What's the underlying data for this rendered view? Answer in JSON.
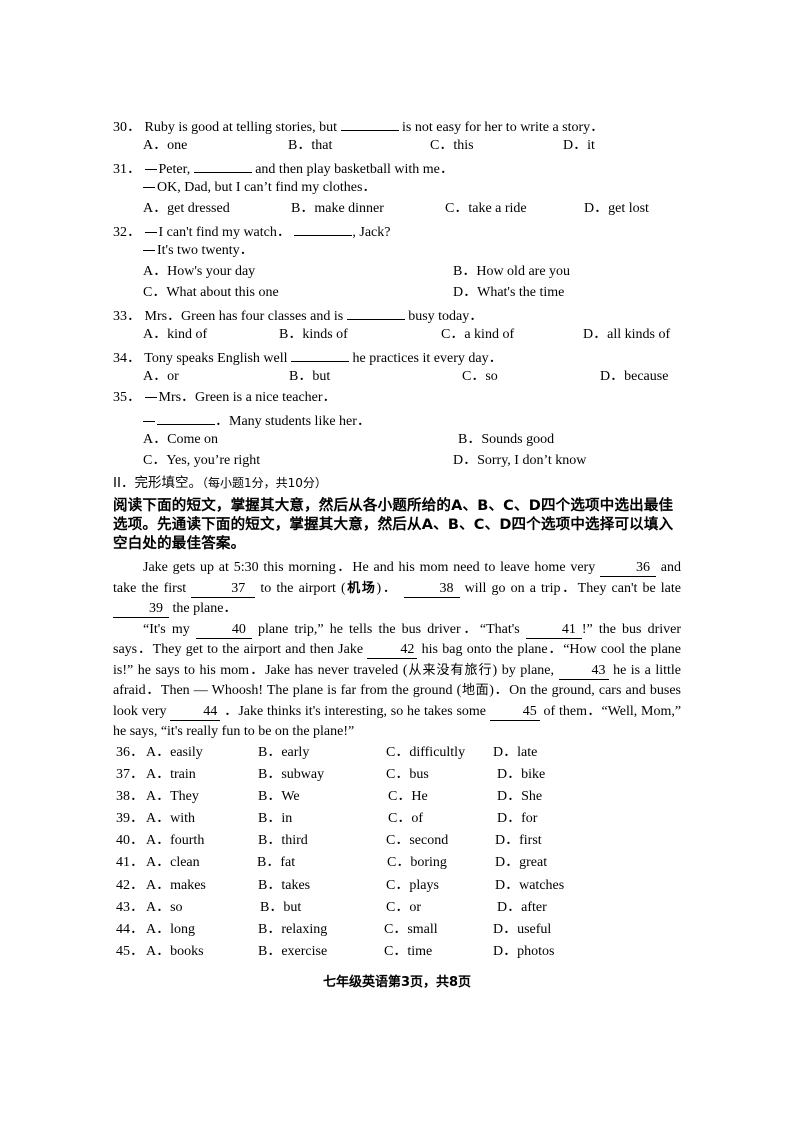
{
  "questions": [
    {
      "num": "30．",
      "stem_before": "Ruby is good at telling stories, but",
      "stem_after": "is not easy for her to write a story．",
      "options": [
        "A．one",
        "B．that",
        "C．this",
        "D．it"
      ]
    },
    {
      "num": "31．",
      "dialog": [
        "Peter,",
        "and then play basketball with me．",
        "OK, Dad, but I can’t find my clothes．"
      ],
      "options": [
        "A．get dressed",
        "B．make dinner",
        "C．take a ride",
        "D．get lost"
      ]
    },
    {
      "num": "32．",
      "dialog": [
        "I can't find my watch．",
        ", Jack?",
        "It's two twenty．"
      ],
      "options": [
        "A．How's your day",
        "B．How old are you",
        "C．What about this one",
        "D．What's the time"
      ]
    },
    {
      "num": "33．",
      "stem_before": "Mrs．Green has four classes and is",
      "stem_after": "busy today．",
      "options": [
        "A．kind of",
        "B．kinds of",
        "C．a kind of",
        "D．all kinds of"
      ]
    },
    {
      "num": "34．",
      "stem_before": "Tony speaks English well",
      "stem_after": "he practices it every day．",
      "options": [
        "A．or",
        "B．but",
        "C．so",
        "D．because"
      ]
    },
    {
      "num": "35．",
      "dialog": [
        "Mrs．Green is a nice teacher．",
        "．Many students like her．"
      ],
      "options": [
        "A．Come on",
        "B．Sounds good",
        "C．Yes, you’re right",
        "D．Sorry, I don’t know"
      ]
    }
  ],
  "section2": {
    "title": "II．完形填空。",
    "points": "（每小题1分，共10分）",
    "instructions": "阅读下面的短文，掌握其大意，然后从各小题所给的A、B、C、D四个选项中选出最佳选项。先通读下面的短文，掌握其大意，然后从A、B、C、D四个选项中选择可以填入空白处的最佳答案。"
  },
  "passage": {
    "p1": {
      "t1": "Jake gets up at 5:30 this morning．He and his mom need to leave home very",
      "b36": "36",
      "t2": "and take the first",
      "b37": "37",
      "t3": "to the airport (",
      "cn1": "机场",
      "t4": ")．",
      "b38": "38",
      "t5": "will go on a trip．They can't be late",
      "b39": "39",
      "t6": "the plane．"
    },
    "p2": {
      "t1": "“It's my",
      "b40": "40",
      "t2": "plane trip,” he tells the bus driver．“That's",
      "b41": "41",
      "t3": "!” the bus driver says．They get to the airport and then Jake",
      "b42": "42",
      "t4": "his bag onto the plane．“How cool the plane is!” he says to his mom．Jake has never traveled (",
      "cn1": "从来没有旅行",
      "t5": ") by plane,",
      "b43": "43",
      "t6": "he is a little afraid．Then — Whoosh! The plane is far from the ground (",
      "cn2": "地面",
      "t7": ")．On the ground, cars and buses look very",
      "b44": "44",
      "t8": "．Jake thinks it's interesting, so he takes some",
      "b45": "45",
      "t9": "of them．“Well, Mom,” he says, “it's really fun to be on the plane!”"
    }
  },
  "cloze": [
    {
      "num": "36．",
      "options": [
        "A．easily",
        "B．early",
        "C．difficultly",
        "D．late"
      ]
    },
    {
      "num": "37．",
      "options": [
        "A．train",
        "B．subway",
        "C．bus",
        "D．bike"
      ]
    },
    {
      "num": "38．",
      "options": [
        "A．They",
        "B．We",
        "C．He",
        "D．She"
      ]
    },
    {
      "num": "39．",
      "options": [
        "A．with",
        "B．in",
        "C．of",
        "D．for"
      ]
    },
    {
      "num": "40．",
      "options": [
        "A．fourth",
        "B．third",
        "C．second",
        "D．first"
      ]
    },
    {
      "num": "41．",
      "options": [
        "A．clean",
        "B．fat",
        "C．boring",
        "D．great"
      ]
    },
    {
      "num": "42．",
      "options": [
        "A．makes",
        "B．takes",
        "C．plays",
        "D．watches"
      ]
    },
    {
      "num": "43．",
      "options": [
        "A．so",
        "B．but",
        "C．or",
        "D．after"
      ]
    },
    {
      "num": "44．",
      "options": [
        "A．long",
        "B．relaxing",
        "C．small",
        "D．useful"
      ]
    },
    {
      "num": "45．",
      "options": [
        "A．books",
        "B．exercise",
        "C．time",
        "D．photos"
      ]
    }
  ],
  "footer": "七年级英语第3页，共8页"
}
